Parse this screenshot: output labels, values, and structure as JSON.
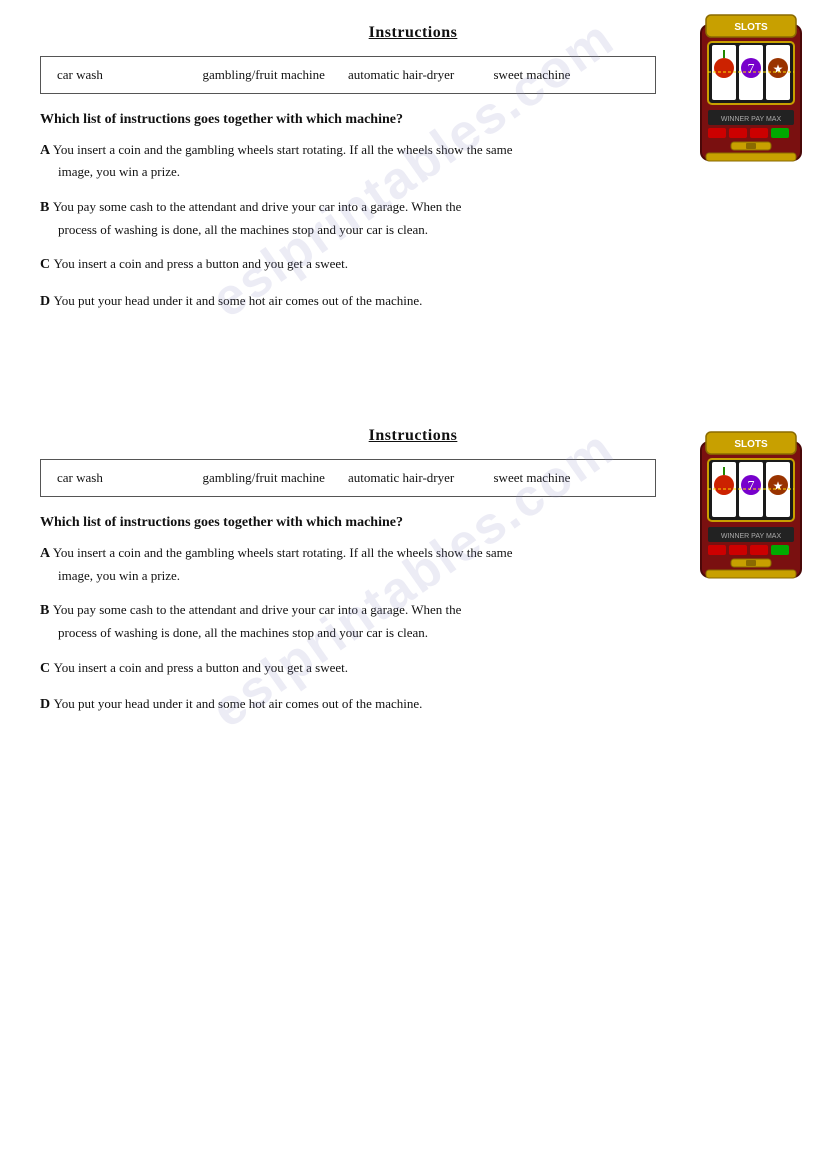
{
  "section1": {
    "title": "Instructions",
    "vocab": {
      "items": [
        "car wash",
        "gambling/fruit machine",
        "automatic hair-dryer",
        "sweet machine"
      ]
    },
    "question": "Which list of instructions goes together with which machine?",
    "exercises": [
      {
        "letter": "A",
        "line1": "You insert a coin and the gambling wheels start rotating. If all the wheels show the same",
        "line2": "image, you win a prize."
      },
      {
        "letter": "B",
        "line1": "You pay some cash to the attendant and drive your car into a garage. When the",
        "line2": "process of washing is done, all the machines stop and your car is clean."
      },
      {
        "letter": "C",
        "line1": "You insert a coin and press a button and you get a sweet.",
        "line2": ""
      },
      {
        "letter": "D",
        "line1": "You put your head under it and some hot air comes out of the machine.",
        "line2": ""
      }
    ]
  },
  "section2": {
    "title": "Instructions",
    "vocab": {
      "items": [
        "car wash",
        "gambling/fruit machine",
        "automatic hair-dryer",
        "sweet machine"
      ]
    },
    "question": "Which list of instructions goes together with which machine?",
    "exercises": [
      {
        "letter": "A",
        "line1": "You insert a coin and the gambling wheels start rotating. If all the wheels show the same",
        "line2": "image, you win a prize."
      },
      {
        "letter": "B",
        "line1": "You pay some cash to the attendant and drive your car into a garage. When the",
        "line2": "process of washing is done, all the machines stop and your car is clean."
      },
      {
        "letter": "C",
        "line1": "You insert a coin and press a button and you get a sweet.",
        "line2": ""
      },
      {
        "letter": "D",
        "line1": "You put your head under it and some hot air comes out of the machine.",
        "line2": ""
      }
    ]
  },
  "watermark": "eslprintables.com"
}
